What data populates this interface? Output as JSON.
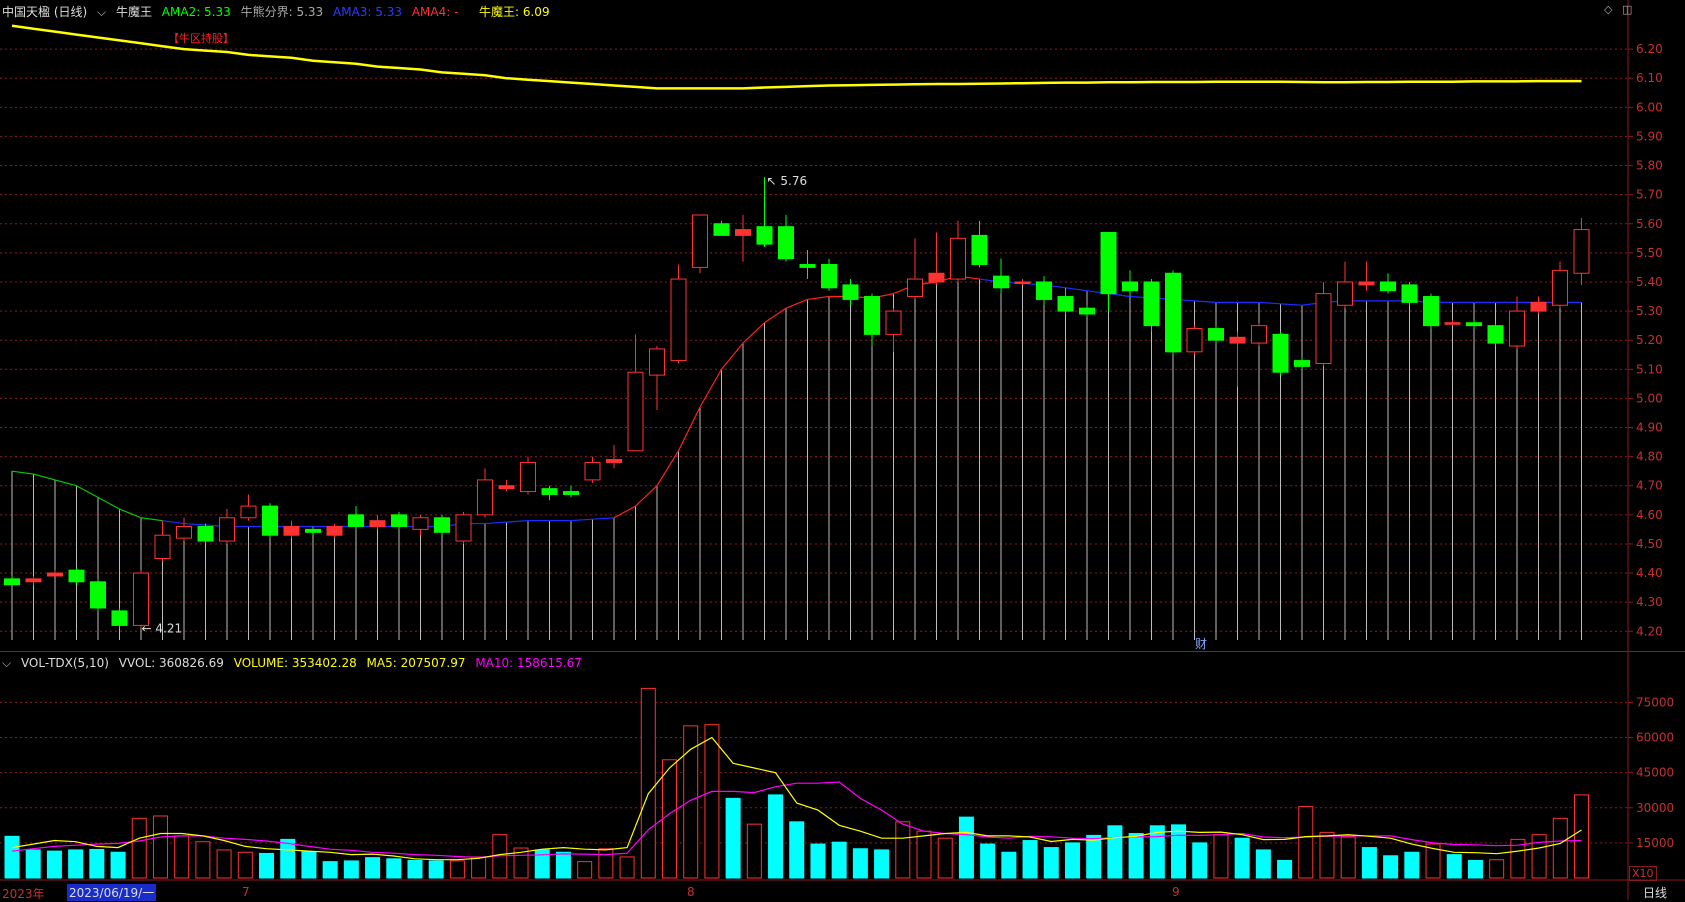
{
  "main_header": {
    "title": "中国天楹 (日线)",
    "indicator": "牛魔王",
    "ama2": "AMA2: 5.33",
    "boundary": "牛熊分界: 5.33",
    "ama3": "AMA3: 5.33",
    "ama4": "AMA4: -",
    "bull_king": "牛魔王: 6.09"
  },
  "vol_header": {
    "name": "VOL-TDX(5,10)",
    "vvol": "VVOL: 360826.69",
    "volume": "VOLUME: 353402.28",
    "ma5": "MA5: 207507.97",
    "ma10": "MA10: 158615.67"
  },
  "annotations": {
    "zone_label": "【牛区持股】",
    "high_label": "5.76",
    "low_label": "4.21",
    "fin_marker": "财",
    "vol_unit": "X10",
    "period": "日线"
  },
  "date_axis": {
    "year": "2023年",
    "cursor_date": "2023/06/19/一",
    "month_7": "7",
    "month_8": "8",
    "month_9": "9"
  },
  "colors": {
    "up": "#ff3232",
    "down": "#00ff00",
    "down_hollow": "#00ff00",
    "vol_up": "#ff3232",
    "vol_down": "#00ffff",
    "bull_line": "#ffff00",
    "ama_blue": "#1e2cff",
    "ama_green": "#00cc00",
    "ama_red": "#ff2020",
    "ma5": "#ffff00",
    "ma10": "#ff00ff",
    "grid": "#8a1c1c"
  },
  "chart_data": [
    {
      "type": "candlestick",
      "title": "中国天楹 (日线)",
      "y_ticks": [
        "4.20",
        "4.30",
        "4.40",
        "4.50",
        "4.60",
        "4.70",
        "4.80",
        "4.90",
        "5.00",
        "5.10",
        "5.20",
        "5.30",
        "5.40",
        "5.50",
        "5.60",
        "5.70",
        "5.80",
        "5.90",
        "6.00",
        "6.10",
        "6.20"
      ],
      "ylim": [
        4.17,
        6.3
      ],
      "candles": [
        {
          "o": 4.38,
          "c": 4.36,
          "h": 4.39,
          "l": 4.36
        },
        {
          "o": 4.37,
          "c": 4.38,
          "h": 4.39,
          "l": 4.36
        },
        {
          "o": 4.39,
          "c": 4.4,
          "h": 4.41,
          "l": 4.39
        },
        {
          "o": 4.41,
          "c": 4.37,
          "h": 4.42,
          "l": 4.36
        },
        {
          "o": 4.37,
          "c": 4.28,
          "h": 4.38,
          "l": 4.27
        },
        {
          "o": 4.27,
          "c": 4.22,
          "h": 4.28,
          "l": 4.21
        },
        {
          "o": 4.22,
          "c": 4.4,
          "h": 4.41,
          "l": 4.21
        },
        {
          "o": 4.45,
          "c": 4.53,
          "h": 4.58,
          "l": 4.44
        },
        {
          "o": 4.52,
          "c": 4.56,
          "h": 4.59,
          "l": 4.51
        },
        {
          "o": 4.56,
          "c": 4.51,
          "h": 4.57,
          "l": 4.5
        },
        {
          "o": 4.51,
          "c": 4.59,
          "h": 4.62,
          "l": 4.5
        },
        {
          "o": 4.59,
          "c": 4.63,
          "h": 4.67,
          "l": 4.58
        },
        {
          "o": 4.63,
          "c": 4.53,
          "h": 4.64,
          "l": 4.52
        },
        {
          "o": 4.53,
          "c": 4.56,
          "h": 4.58,
          "l": 4.52
        },
        {
          "o": 4.55,
          "c": 4.54,
          "h": 4.56,
          "l": 4.53
        },
        {
          "o": 4.53,
          "c": 4.56,
          "h": 4.57,
          "l": 4.52
        },
        {
          "o": 4.6,
          "c": 4.56,
          "h": 4.63,
          "l": 4.55
        },
        {
          "o": 4.56,
          "c": 4.58,
          "h": 4.6,
          "l": 4.55
        },
        {
          "o": 4.6,
          "c": 4.56,
          "h": 4.61,
          "l": 4.55
        },
        {
          "o": 4.55,
          "c": 4.59,
          "h": 4.6,
          "l": 4.53
        },
        {
          "o": 4.59,
          "c": 4.54,
          "h": 4.6,
          "l": 4.53
        },
        {
          "o": 4.51,
          "c": 4.6,
          "h": 4.61,
          "l": 4.5
        },
        {
          "o": 4.6,
          "c": 4.72,
          "h": 4.76,
          "l": 4.59
        },
        {
          "o": 4.69,
          "c": 4.7,
          "h": 4.72,
          "l": 4.68
        },
        {
          "o": 4.68,
          "c": 4.78,
          "h": 4.8,
          "l": 4.67
        },
        {
          "o": 4.69,
          "c": 4.67,
          "h": 4.7,
          "l": 4.65
        },
        {
          "o": 4.68,
          "c": 4.67,
          "h": 4.7,
          "l": 4.66
        },
        {
          "o": 4.72,
          "c": 4.78,
          "h": 4.8,
          "l": 4.71
        },
        {
          "o": 4.78,
          "c": 4.79,
          "h": 4.84,
          "l": 4.76
        },
        {
          "o": 4.82,
          "c": 5.09,
          "h": 5.22,
          "l": 4.82
        },
        {
          "o": 5.08,
          "c": 5.17,
          "h": 5.18,
          "l": 4.96
        },
        {
          "o": 5.13,
          "c": 5.41,
          "h": 5.46,
          "l": 5.12
        },
        {
          "o": 5.45,
          "c": 5.63,
          "h": 5.63,
          "l": 5.43
        },
        {
          "o": 5.6,
          "c": 5.56,
          "h": 5.61,
          "l": 5.56
        },
        {
          "o": 5.56,
          "c": 5.58,
          "h": 5.63,
          "l": 5.47
        },
        {
          "o": 5.59,
          "c": 5.53,
          "h": 5.76,
          "l": 5.52
        },
        {
          "o": 5.59,
          "c": 5.48,
          "h": 5.63,
          "l": 5.47
        },
        {
          "o": 5.46,
          "c": 5.45,
          "h": 5.51,
          "l": 5.41
        },
        {
          "o": 5.46,
          "c": 5.38,
          "h": 5.48,
          "l": 5.37
        },
        {
          "o": 5.39,
          "c": 5.34,
          "h": 5.41,
          "l": 5.32
        },
        {
          "o": 5.35,
          "c": 5.22,
          "h": 5.36,
          "l": 5.18
        },
        {
          "o": 5.22,
          "c": 5.3,
          "h": 5.31,
          "l": 5.16
        },
        {
          "o": 5.35,
          "c": 5.41,
          "h": 5.55,
          "l": 5.34
        },
        {
          "o": 5.4,
          "c": 5.43,
          "h": 5.57,
          "l": 5.39
        },
        {
          "o": 5.41,
          "c": 5.55,
          "h": 5.61,
          "l": 5.4
        },
        {
          "o": 5.56,
          "c": 5.46,
          "h": 5.61,
          "l": 5.45
        },
        {
          "o": 5.42,
          "c": 5.38,
          "h": 5.48,
          "l": 5.36
        },
        {
          "o": 5.4,
          "c": 5.4,
          "h": 5.41,
          "l": 5.39
        },
        {
          "o": 5.4,
          "c": 5.34,
          "h": 5.42,
          "l": 5.32
        },
        {
          "o": 5.35,
          "c": 5.3,
          "h": 5.38,
          "l": 5.29
        },
        {
          "o": 5.31,
          "c": 5.29,
          "h": 5.32,
          "l": 5.28
        },
        {
          "o": 5.57,
          "c": 5.36,
          "h": 5.57,
          "l": 5.3
        },
        {
          "o": 5.4,
          "c": 5.37,
          "h": 5.44,
          "l": 5.35
        },
        {
          "o": 5.4,
          "c": 5.25,
          "h": 5.41,
          "l": 5.23
        },
        {
          "o": 5.43,
          "c": 5.16,
          "h": 5.44,
          "l": 5.15
        },
        {
          "o": 5.16,
          "c": 5.24,
          "h": 5.25,
          "l": 5.15
        },
        {
          "o": 5.24,
          "c": 5.2,
          "h": 5.25,
          "l": 5.19
        },
        {
          "o": 5.19,
          "c": 5.21,
          "h": 5.23,
          "l": 5.04
        },
        {
          "o": 5.19,
          "c": 5.25,
          "h": 5.26,
          "l": 5.18
        },
        {
          "o": 5.22,
          "c": 5.09,
          "h": 5.23,
          "l": 5.08
        },
        {
          "o": 5.13,
          "c": 5.11,
          "h": 5.14,
          "l": 5.1
        },
        {
          "o": 5.12,
          "c": 5.36,
          "h": 5.4,
          "l": 5.11
        },
        {
          "o": 5.32,
          "c": 5.4,
          "h": 5.47,
          "l": 5.31
        },
        {
          "o": 5.39,
          "c": 5.4,
          "h": 5.47,
          "l": 5.37
        },
        {
          "o": 5.4,
          "c": 5.37,
          "h": 5.43,
          "l": 5.36
        },
        {
          "o": 5.39,
          "c": 5.33,
          "h": 5.4,
          "l": 5.32
        },
        {
          "o": 5.35,
          "c": 5.25,
          "h": 5.36,
          "l": 5.24
        },
        {
          "o": 5.26,
          "c": 5.26,
          "h": 5.27,
          "l": 5.25
        },
        {
          "o": 5.26,
          "c": 5.25,
          "h": 5.27,
          "l": 5.24
        },
        {
          "o": 5.25,
          "c": 5.19,
          "h": 5.26,
          "l": 5.18
        },
        {
          "o": 5.18,
          "c": 5.3,
          "h": 5.35,
          "l": 5.17
        },
        {
          "o": 5.3,
          "c": 5.33,
          "h": 5.35,
          "l": 5.29
        },
        {
          "o": 5.32,
          "c": 5.44,
          "h": 5.47,
          "l": 5.31
        },
        {
          "o": 5.43,
          "c": 5.58,
          "h": 5.62,
          "l": 5.39
        }
      ],
      "bull_line": [
        6.28,
        6.27,
        6.26,
        6.25,
        6.24,
        6.23,
        6.22,
        6.21,
        6.2,
        6.195,
        6.19,
        6.18,
        6.175,
        6.17,
        6.16,
        6.155,
        6.15,
        6.14,
        6.135,
        6.13,
        6.12,
        6.115,
        6.11,
        6.1,
        6.095,
        6.09,
        6.085,
        6.08,
        6.075,
        6.07,
        6.065,
        6.065,
        6.065,
        6.065,
        6.065,
        6.068,
        6.07,
        6.073,
        6.075,
        6.076,
        6.077,
        6.078,
        6.079,
        6.08,
        6.08,
        6.081,
        6.082,
        6.083,
        6.084,
        6.085,
        6.085,
        6.086,
        6.086,
        6.087,
        6.087,
        6.087,
        6.088,
        6.088,
        6.088,
        6.088,
        6.087,
        6.086,
        6.086,
        6.087,
        6.087,
        6.088,
        6.088,
        6.088,
        6.089,
        6.089,
        6.089,
        6.09,
        6.09,
        6.09
      ],
      "ama_line": [
        4.75,
        4.74,
        4.72,
        4.7,
        4.66,
        4.62,
        4.59,
        4.58,
        4.57,
        4.565,
        4.56,
        4.56,
        4.56,
        4.56,
        4.56,
        4.56,
        4.56,
        4.56,
        4.56,
        4.56,
        4.56,
        4.57,
        4.57,
        4.575,
        4.58,
        4.58,
        4.58,
        4.585,
        4.59,
        4.63,
        4.7,
        4.82,
        4.97,
        5.1,
        5.19,
        5.26,
        5.31,
        5.34,
        5.35,
        5.35,
        5.345,
        5.36,
        5.39,
        5.4,
        5.42,
        5.41,
        5.4,
        5.395,
        5.39,
        5.38,
        5.37,
        5.36,
        5.35,
        5.345,
        5.34,
        5.335,
        5.33,
        5.33,
        5.33,
        5.325,
        5.32,
        5.33,
        5.335,
        5.335,
        5.335,
        5.335,
        5.33,
        5.33,
        5.33,
        5.33,
        5.33,
        5.33,
        5.33,
        5.33
      ]
    },
    {
      "type": "bar",
      "title": "VOL-TDX(5,10)",
      "y_ticks": [
        "15000",
        "30000",
        "45000",
        "60000",
        "75000"
      ],
      "ylim": [
        0,
        88000
      ],
      "volumes": [
        17800,
        12000,
        11500,
        12000,
        12200,
        11000,
        25500,
        26500,
        18000,
        15500,
        12000,
        11000,
        10500,
        16500,
        11200,
        7000,
        7300,
        8700,
        8200,
        7500,
        7300,
        7300,
        9000,
        18500,
        12800,
        12000,
        11000,
        7000,
        12500,
        9000,
        81000,
        50500,
        65000,
        65500,
        34000,
        23000,
        35500,
        24000,
        14500,
        15300,
        12500,
        12000,
        24000,
        20000,
        17000,
        26000,
        14500,
        11000,
        16000,
        13000,
        15000,
        18200,
        22300,
        19000,
        22300,
        22700,
        15000,
        18500,
        17000,
        12000,
        7500,
        30500,
        19500,
        17500,
        13000,
        9500,
        11000,
        14500,
        10000,
        7500,
        7800,
        16500,
        18500,
        25500,
        35500
      ],
      "ma5": [
        13000,
        14500,
        16000,
        15500,
        13500,
        13000,
        17000,
        19000,
        19000,
        18000,
        16000,
        13500,
        12500,
        12000,
        11500,
        11000,
        10000,
        10200,
        9400,
        8200,
        7800,
        7800,
        8400,
        10000,
        11000,
        12300,
        13000,
        12300,
        12000,
        13000,
        36000,
        47000,
        55000,
        60000,
        49000,
        47000,
        45000,
        32000,
        29000,
        22500,
        20000,
        17000,
        17000,
        18000,
        19000,
        19500,
        18000,
        18000,
        17500,
        15600,
        16500,
        16200,
        17200,
        17800,
        19500,
        20000,
        19500,
        19600,
        18500,
        16400,
        16500,
        17700,
        18000,
        18500,
        17800,
        17000,
        14500,
        12600,
        11000,
        10800,
        10400,
        11500,
        12800,
        14800,
        20500
      ],
      "ma10": [
        11500,
        12500,
        13500,
        14000,
        14500,
        14800,
        15800,
        17500,
        18000,
        18000,
        17000,
        16500,
        15800,
        14800,
        13500,
        12300,
        11800,
        11000,
        10600,
        10000,
        9700,
        9200,
        8800,
        9500,
        9700,
        9900,
        10300,
        10200,
        10000,
        10600,
        20600,
        27500,
        33200,
        37000,
        37000,
        36500,
        39000,
        40500,
        40500,
        41000,
        34000,
        29000,
        23000,
        20000,
        19000,
        18500,
        17500,
        17000,
        17800,
        17600,
        17000,
        16800,
        17300,
        17600,
        17700,
        18300,
        18200,
        18500,
        19000,
        17500,
        17200,
        17500,
        17800,
        18000,
        18000,
        18000,
        16400,
        15000,
        14300,
        14200,
        13800,
        14000,
        15200,
        15800,
        16000
      ],
      "volume_up": [
        false,
        false,
        false,
        false,
        false,
        false,
        true,
        true,
        true,
        true,
        true,
        true,
        false,
        false,
        false,
        false,
        false,
        false,
        false,
        false,
        false,
        true,
        true,
        true,
        true,
        false,
        false,
        true,
        true,
        true,
        true,
        true,
        true,
        true,
        false,
        true,
        false,
        false,
        false,
        false,
        false,
        false,
        true,
        true,
        true,
        false,
        false,
        false,
        false,
        false,
        false,
        false,
        false,
        false,
        false,
        false,
        false,
        true,
        false,
        false,
        false,
        true,
        true,
        true,
        false,
        false,
        false,
        true,
        false,
        false,
        true,
        true,
        true,
        true,
        true
      ]
    }
  ]
}
